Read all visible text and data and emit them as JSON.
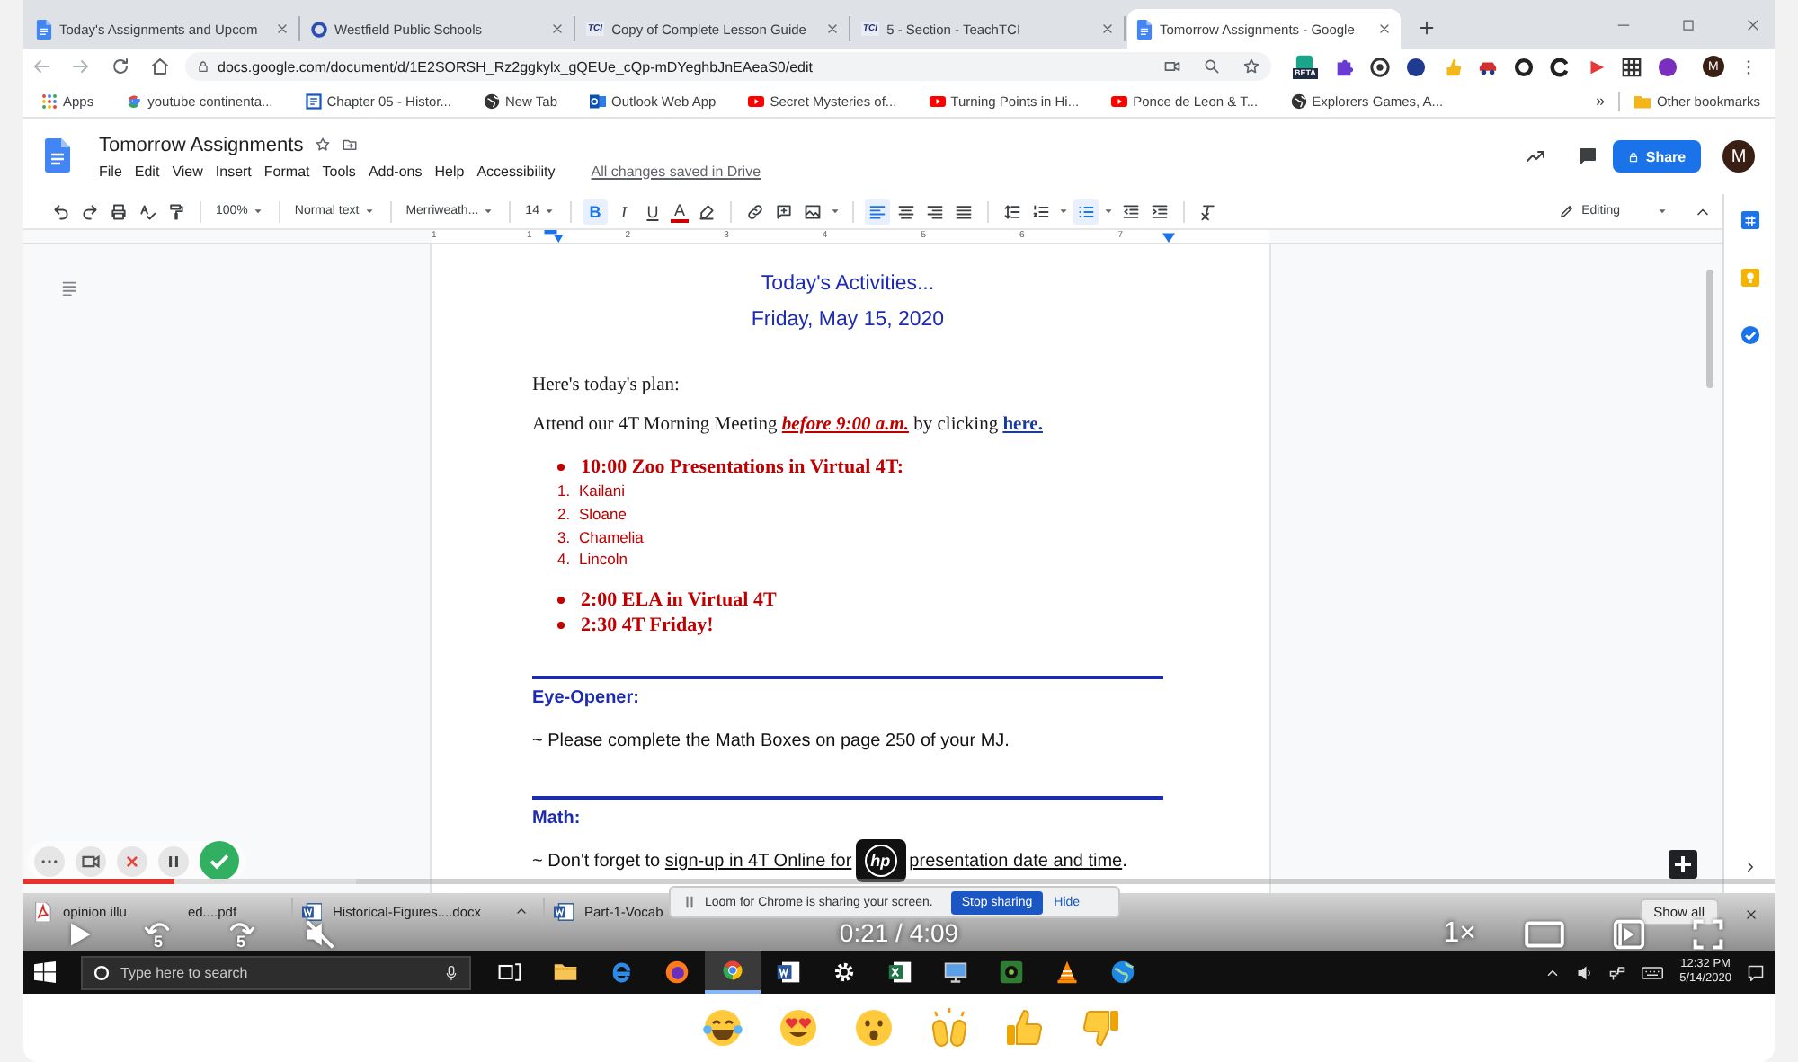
{
  "browser": {
    "tabs": [
      {
        "title": "Today's Assignments and Upcom",
        "kind": "docs",
        "selected": false
      },
      {
        "title": "Westfield Public Schools",
        "kind": "ring",
        "selected": false
      },
      {
        "title": "Copy of Complete Lesson Guide",
        "kind": "tci",
        "icon_text": "TCI",
        "selected": false
      },
      {
        "title": "5 - Section - TeachTCI",
        "kind": "tci",
        "icon_text": "TCI",
        "selected": false
      },
      {
        "title": "Tomorrow Assignments - Google",
        "kind": "docs",
        "selected": true
      }
    ],
    "address": "docs.google.com/document/d/1E2SORSH_Rz2ggkylx_gQEUe_cQp-mDYeghbJnEAeaS0/edit",
    "extension_badge": "BETA",
    "profile_initial": "M",
    "bookmarks": [
      {
        "label": "Apps",
        "kind": "grid"
      },
      {
        "label": "youtube continenta...",
        "kind": "google"
      },
      {
        "label": "Chapter 05 - Histor...",
        "kind": "doc"
      },
      {
        "label": "New Tab",
        "kind": "globe"
      },
      {
        "label": "Outlook Web App",
        "kind": "outlook"
      },
      {
        "label": "Secret Mysteries of...",
        "kind": "youtube"
      },
      {
        "label": "Turning Points in Hi...",
        "kind": "youtube"
      },
      {
        "label": "Ponce de Leon & T...",
        "kind": "youtube"
      },
      {
        "label": "Explorers Games, A...",
        "kind": "globe"
      }
    ],
    "bookmarks_more": "»",
    "other_bookmarks": "Other bookmarks"
  },
  "docs": {
    "title": "Tomorrow Assignments",
    "menu": [
      "File",
      "Edit",
      "View",
      "Insert",
      "Format",
      "Tools",
      "Add-ons",
      "Help",
      "Accessibility"
    ],
    "save_status": "All changes saved in Drive",
    "share_label": "Share",
    "avatar_initial": "M",
    "toolbar": [
      {
        "kind": "undo"
      },
      {
        "kind": "redo"
      },
      {
        "kind": "print"
      },
      {
        "kind": "spellcheck"
      },
      {
        "kind": "paint-format"
      },
      {
        "kind": "divider"
      },
      {
        "kind": "dropdown",
        "label": "100%"
      },
      {
        "kind": "divider"
      },
      {
        "kind": "dropdown",
        "label": "Normal text"
      },
      {
        "kind": "divider"
      },
      {
        "kind": "dropdown",
        "label": "Merriweath..."
      },
      {
        "kind": "divider"
      },
      {
        "kind": "dropdown",
        "label": "14"
      },
      {
        "kind": "divider"
      },
      {
        "kind": "bold",
        "label": "B",
        "selected": true
      },
      {
        "kind": "italic",
        "label": "I",
        "selected": false
      },
      {
        "kind": "underline",
        "label": "U",
        "selected": false
      },
      {
        "kind": "text-color",
        "label": "A",
        "color": "#cc0000"
      },
      {
        "kind": "highlight"
      },
      {
        "kind": "divider"
      },
      {
        "kind": "link"
      },
      {
        "kind": "comment"
      },
      {
        "kind": "image"
      },
      {
        "kind": "divider"
      },
      {
        "kind": "align-left",
        "selected": true
      },
      {
        "kind": "align-center",
        "selected": false
      },
      {
        "kind": "align-right",
        "selected": false
      },
      {
        "kind": "justify",
        "selected": false
      },
      {
        "kind": "divider"
      },
      {
        "kind": "line-spacing"
      },
      {
        "kind": "numbered-list",
        "selected": false
      },
      {
        "kind": "bulleted-list",
        "selected": true
      },
      {
        "kind": "indent-less"
      },
      {
        "kind": "indent-more"
      },
      {
        "kind": "divider"
      },
      {
        "kind": "clear-format"
      }
    ],
    "mode_label": "Editing",
    "ruler_labels": [
      "1",
      "1",
      "2",
      "3",
      "4",
      "5",
      "6",
      "7"
    ]
  },
  "document": {
    "heading": [
      "Today's Activities...",
      "Friday, May 15, 2020"
    ],
    "intro": "Here's today's plan:",
    "meeting": {
      "lead": "Attend our 4T Morning Meeting",
      "emphasis": "before 9:00 a.m.",
      "middle": "by clicking",
      "link": "here."
    },
    "schedule": [
      {
        "text": "10:00 Zoo Presentations in Virtual 4T:",
        "children": [
          {
            "number": "1.",
            "text": "Kailani"
          },
          {
            "number": "2.",
            "text": "Sloane"
          },
          {
            "number": "3.",
            "text": "Chamelia"
          },
          {
            "number": "4.",
            "text": "Lincoln"
          }
        ]
      },
      {
        "text": "2:00 ELA in Virtual 4T"
      },
      {
        "text": "2:30 4T Friday!"
      }
    ],
    "sections": [
      {
        "heading": "Eye-Opener:",
        "kind": "plain",
        "text": "~ Please complete the Math Boxes on page 250 of your MJ."
      },
      {
        "heading": "Math:",
        "kind": "links",
        "text": "~ Don't forget to",
        "link": "sign-up in 4T Online for",
        "link_2": "presentation date and time",
        "end": "."
      }
    ],
    "logo_text": "hp"
  },
  "downloads": {
    "items": [
      {
        "kind": "pdf",
        "name": "opinion illu",
        "name_tail": "ed....pdf",
        "caret": false
      },
      {
        "kind": "word",
        "name": "Historical-Figures....docx",
        "caret": true
      },
      {
        "kind": "word",
        "name": "Part-1-Vocab",
        "caret": false
      }
    ],
    "show_all": "Show all"
  },
  "player": {
    "progress": {
      "level": 0.086
    },
    "buffered": {
      "level": 0.19
    },
    "skip_back": "5",
    "skip_forward": "5",
    "muted": true,
    "time": "0:21 / 4:09",
    "speed": "1×"
  },
  "loom": {
    "recording_controls": [
      {
        "kind": "more"
      },
      {
        "kind": "camera"
      },
      {
        "kind": "cancel"
      },
      {
        "kind": "pause"
      },
      {
        "kind": "done"
      }
    ],
    "message": "Loom for Chrome is sharing your screen.",
    "stop_label": "Stop sharing",
    "hide_label": "Hide"
  },
  "taskbar": {
    "search_placeholder": "Type here to search",
    "apps": [
      {
        "kind": "task-view",
        "selected": false
      },
      {
        "kind": "folder",
        "selected": false
      },
      {
        "kind": "edge",
        "selected": false
      },
      {
        "kind": "firefox",
        "selected": false
      },
      {
        "kind": "chrome",
        "selected": true
      },
      {
        "kind": "word",
        "selected": false
      },
      {
        "kind": "gear",
        "selected": false
      },
      {
        "kind": "excel",
        "selected": false
      },
      {
        "kind": "monitor",
        "selected": false
      },
      {
        "kind": "webcam",
        "selected": false
      },
      {
        "kind": "cone",
        "selected": false
      },
      {
        "kind": "globe",
        "selected": false
      }
    ],
    "time": "12:32 PM",
    "date": "5/14/2020"
  },
  "reactions": [
    {
      "kind": "laugh"
    },
    {
      "kind": "heart-eyes"
    },
    {
      "kind": "surprised"
    },
    {
      "kind": "raised-hands"
    },
    {
      "kind": "thumbs-up"
    },
    {
      "kind": "thumbs-down"
    }
  ]
}
